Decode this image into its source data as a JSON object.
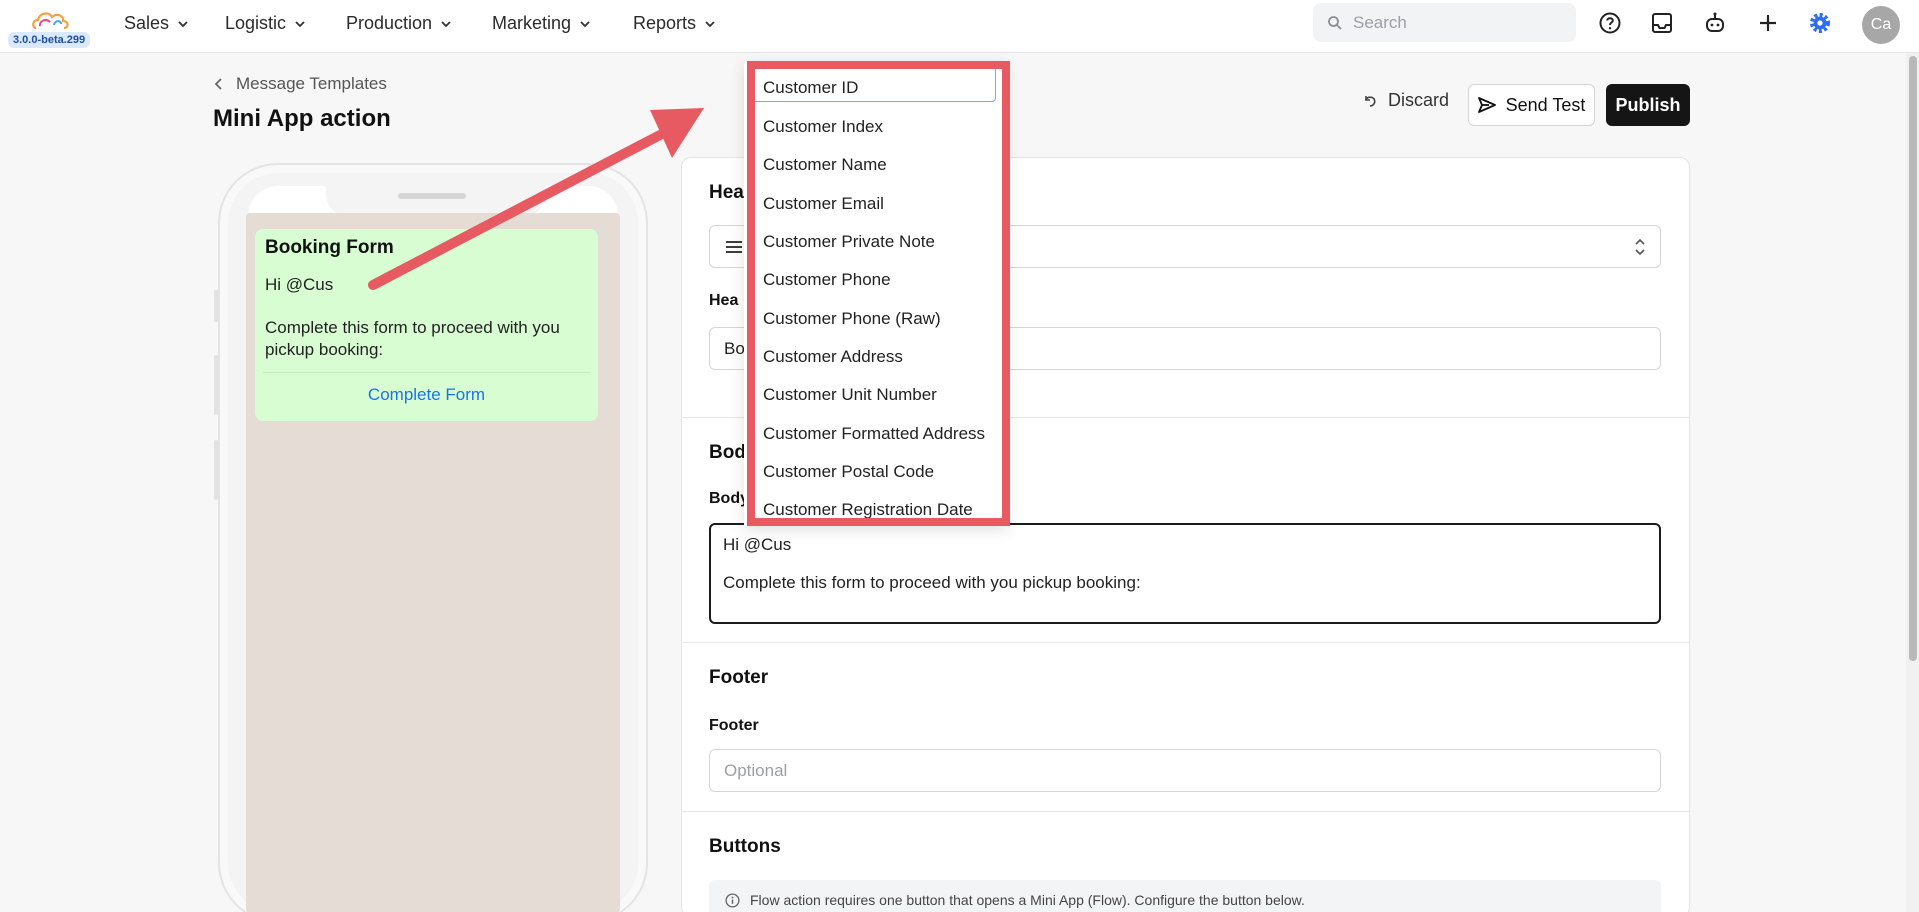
{
  "app": {
    "version": "3.0.0-beta.299",
    "avatar_initials": "Ca"
  },
  "nav": {
    "items": [
      {
        "label": "Sales"
      },
      {
        "label": "Logistic"
      },
      {
        "label": "Production"
      },
      {
        "label": "Marketing"
      },
      {
        "label": "Reports"
      }
    ],
    "search_placeholder": "Search"
  },
  "header": {
    "breadcrumb": "Message Templates",
    "title": "Mini App action",
    "discard_label": "Discard",
    "send_test_label": "Send Test",
    "publish_label": "Publish"
  },
  "preview": {
    "title": "Booking Form",
    "greeting": "Hi @Cus",
    "body": "Complete this form to proceed with you pickup booking:",
    "action": "Complete Form"
  },
  "form": {
    "header_section_title": "Hea",
    "header_field_label": "Hea",
    "header_value": "Bo",
    "body_section_title": "Bod",
    "body_field_label": "Body",
    "body_line1": "Hi @Cus",
    "body_line2": "Complete this form to proceed with you pickup booking:",
    "footer_section_title": "Footer",
    "footer_field_label": "Footer",
    "footer_placeholder": "Optional",
    "buttons_section_title": "Buttons",
    "buttons_info": "Flow action requires one button that opens a Mini App (Flow). Configure the button below."
  },
  "dropdown": {
    "items": [
      "Customer ID",
      "Customer Index",
      "Customer Name",
      "Customer Email",
      "Customer Private Note",
      "Customer Phone",
      "Customer Phone (Raw)",
      "Customer Address",
      "Customer Unit Number",
      "Customer Formatted Address",
      "Customer Postal Code",
      "Customer Registration Date"
    ]
  },
  "colors": {
    "annotation": "#e85a62",
    "link": "#1a73e8",
    "bubble": "#d9fdd3",
    "chat_bg": "#e5ddd5",
    "accent": "#2f6fed"
  }
}
